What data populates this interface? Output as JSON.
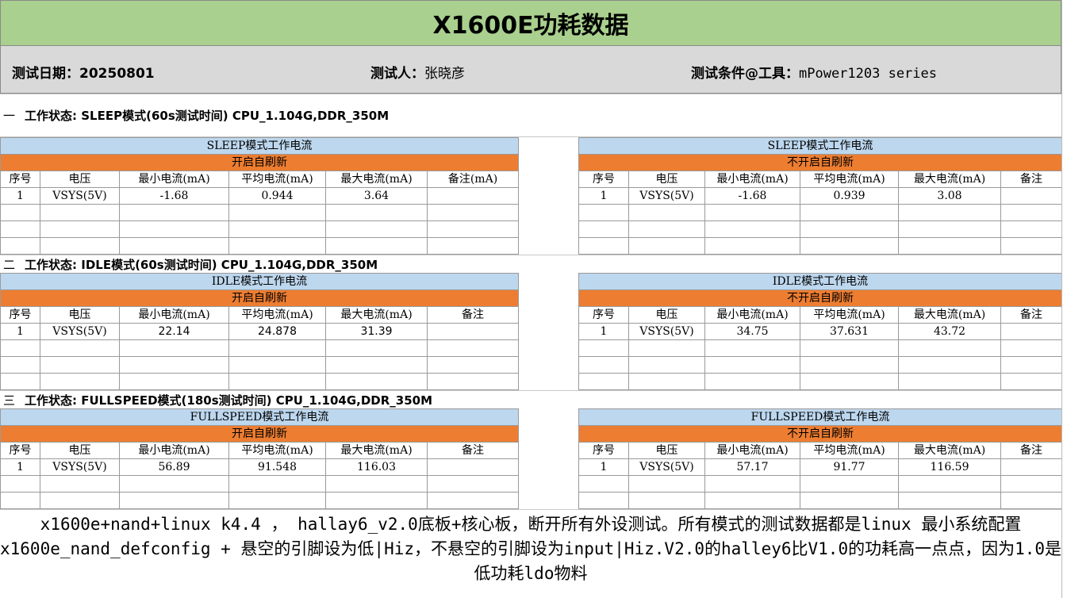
{
  "title": "X1600E功耗数据",
  "info": {
    "date_label": "测试日期：",
    "date_value": "20250801",
    "tester_label": "测试人：",
    "tester_value": "张晓彦",
    "cond_label": "测试条件@工具：",
    "cond_value": "mPower1203 series"
  },
  "sections": [
    {
      "num": "一",
      "title": "工作状态: SLEEP模式(60s测试时间)  CPU_1.104G,DDR_350M",
      "left": {
        "header": "SLEEP模式工作电流",
        "sub": "开启自刷新",
        "cols": [
          "序号",
          "电压",
          "最小电流(mA)",
          "平均电流(mA)",
          "最大电流(mA)",
          "备注(mA)"
        ],
        "row": [
          "1",
          "VSYS(5V)",
          "-1.68",
          "0.944",
          "3.64",
          ""
        ]
      },
      "right": {
        "header": "SLEEP模式工作电流",
        "sub": "不开启自刷新",
        "cols": [
          "序号",
          "电压",
          "最小电流(mA)",
          "平均电流(mA)",
          "最大电流(mA)",
          "备注"
        ],
        "row": [
          "1",
          "VSYS(5V)",
          "-1.68",
          "0.939",
          "3.08",
          ""
        ]
      }
    },
    {
      "num": "二",
      "title": "工作状态: IDLE模式(60s测试时间)  CPU_1.104G,DDR_350M",
      "left": {
        "header": "IDLE模式工作电流",
        "sub": "开启自刷新",
        "cols": [
          "序号",
          "电压",
          "最小电流(mA)",
          "平均电流(mA)",
          "最大电流(mA)",
          "备注"
        ],
        "row": [
          "1",
          "VSYS(5V)",
          "22.14",
          "24.878",
          "31.39",
          ""
        ]
      },
      "right": {
        "header": "IDLE模式工作电流",
        "sub": "不开启自刷新",
        "cols": [
          "序号",
          "电压",
          "最小电流(mA)",
          "平均电流(mA)",
          "最大电流(mA)",
          "备注"
        ],
        "row": [
          "1",
          "VSYS(5V)",
          "34.75",
          "37.631",
          "43.72",
          ""
        ]
      }
    },
    {
      "num": "三",
      "title": "工作状态: FULLSPEED模式(180s测试时间)  CPU_1.104G,DDR_350M",
      "left": {
        "header": "FULLSPEED模式工作电流",
        "sub": "开启自刷新",
        "cols": [
          "序号",
          "电压",
          "最小电流(mA)",
          "平均电流(mA)",
          "最大电流(mA)",
          "备注"
        ],
        "row": [
          "1",
          "VSYS(5V)",
          "56.89",
          "91.548",
          "116.03",
          ""
        ]
      },
      "right": {
        "header": "FULLSPEED模式工作电流",
        "sub": "不开启自刷新",
        "cols": [
          "序号",
          "电压",
          "最小电流(mA)",
          "平均电流(mA)",
          "最大电流(mA)",
          "备注"
        ],
        "row": [
          "1",
          "VSYS(5V)",
          "57.17",
          "91.77",
          "116.59",
          ""
        ]
      }
    }
  ],
  "note": "x1600e+nand+linux k4.4 ，  hallay6_v2.0底板+核心板，断开所有外设测试。所有模式的测试数据都是linux 最小系统配置x1600e_nand_defconfig + 悬空的引脚设为低|Hiz，不悬空的引脚设为input|Hiz.V2.0的halley6比V1.0的功耗高一点点，因为1.0是低功耗ldo物料",
  "colors": {
    "title_bg": "#a9d08e",
    "info_bg": "#d9d9d9",
    "header_blue": "#bdd7ee",
    "header_orange": "#ed7d31"
  }
}
